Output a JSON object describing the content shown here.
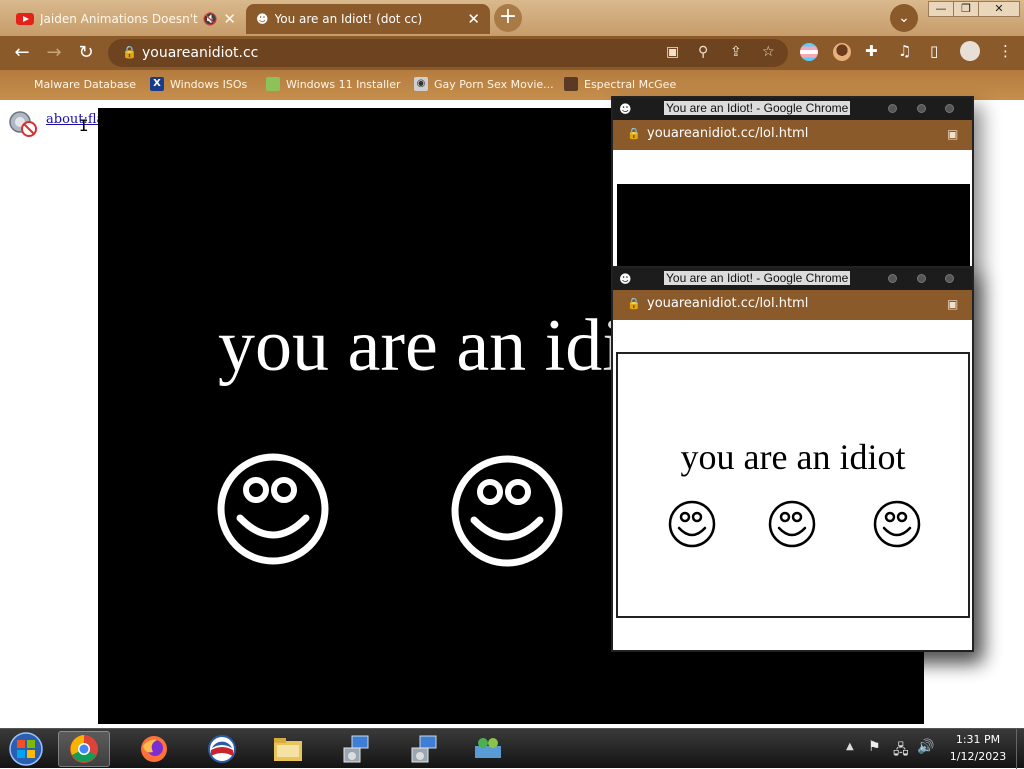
{
  "tabs": [
    {
      "title": "Jaiden Animations Doesn't D",
      "icon": "youtube-icon",
      "audio": "muted"
    },
    {
      "title": "You are an Idiot! (dot cc)",
      "icon": "smiley-icon",
      "active": true
    }
  ],
  "window": {
    "min": "—",
    "max": "❐",
    "close": "✕"
  },
  "toolbar": {
    "url": "youareanidiot.cc"
  },
  "bookmarks": [
    {
      "label": "Malware Database"
    },
    {
      "label": "Windows ISOs"
    },
    {
      "label": "Windows 11 Installer"
    },
    {
      "label": "Gay Porn Sex Movie..."
    },
    {
      "label": "Espectral McGee"
    }
  ],
  "page": {
    "flash_link": "about:flags",
    "stage_text": "you are an idiot"
  },
  "popups": [
    {
      "title": "You are an Idiot! - Google Chrome",
      "url": "youareanidiot.cc/lol.html"
    },
    {
      "title": "You are an Idiot! - Google Chrome",
      "url": "youareanidiot.cc/lol.html",
      "text": "you are an idiot"
    }
  ],
  "taskbar": {
    "apps": [
      "start-orb",
      "chrome",
      "firefox",
      "obama",
      "file-explorer",
      "setup",
      "setup",
      "users"
    ],
    "time": "1:31 PM",
    "date": "1/12/2023"
  },
  "colors": {
    "toolbar": "#8b5a2b",
    "titlebar": "#c79c6a",
    "stage": "#000000"
  }
}
